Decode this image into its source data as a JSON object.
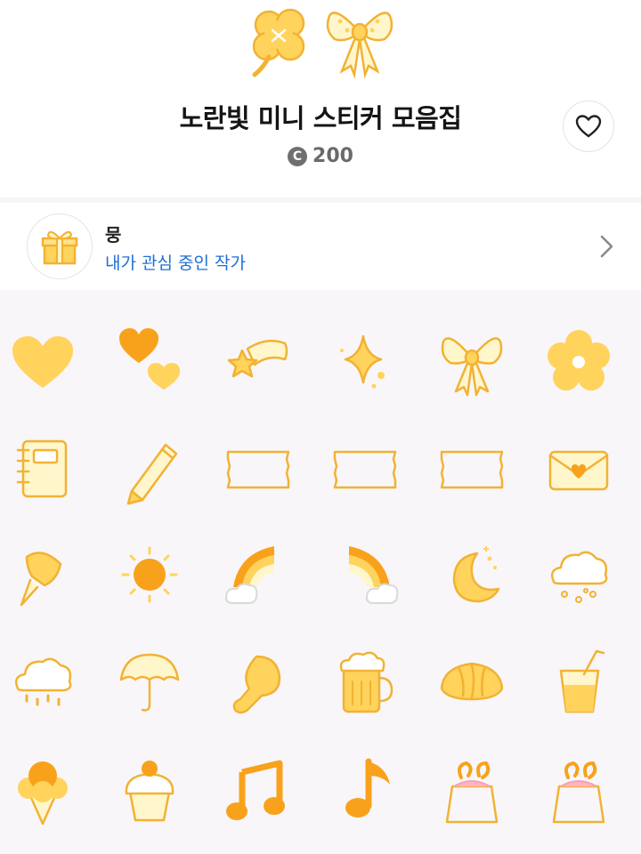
{
  "product": {
    "title": "노란빛 미니 스티커 모음집",
    "coin_symbol": "C",
    "price": "200",
    "like_icon": "heart-outline-icon"
  },
  "author": {
    "name": "뭉",
    "subtitle": "내가 관심 중인 작가",
    "avatar_icon": "gift-box-icon"
  },
  "colors": {
    "accent_yellow": "#f9c74f",
    "accent_orange": "#f8a21b",
    "outline": "#f2b233",
    "link_blue": "#1f6fd6",
    "grid_bg": "#f8f6f9"
  },
  "stickers": [
    [
      "heart",
      "two-hearts",
      "shooting-star",
      "sparkle",
      "bow",
      "flower"
    ],
    [
      "notebook",
      "pencil",
      "gingham-tape",
      "gingham-tape",
      "gingham-tape",
      "envelope"
    ],
    [
      "push-pin",
      "sun",
      "rainbow-left",
      "rainbow-right",
      "moon",
      "snow-cloud"
    ],
    [
      "rain-cloud",
      "umbrella",
      "chicken-leg",
      "beer-mug",
      "croissant",
      "juice-cup"
    ],
    [
      "ice-cream",
      "cupcake",
      "beamed-notes",
      "eighth-note",
      "candy-bag",
      "candy-bag"
    ]
  ]
}
